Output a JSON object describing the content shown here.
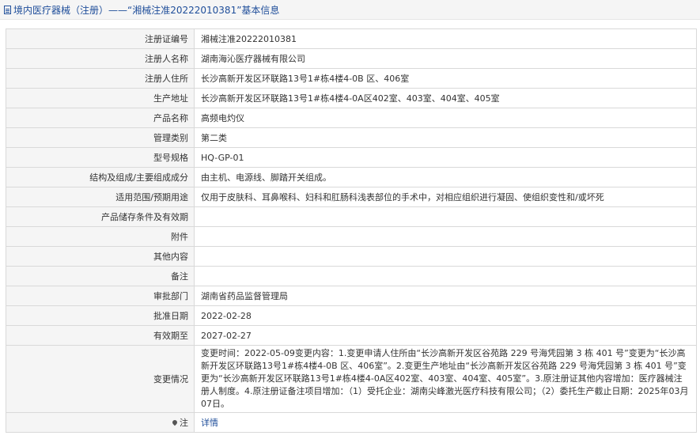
{
  "header": {
    "title": "境内医疗器械（注册）——“湘械注准20222010381”基本信息"
  },
  "rows": [
    {
      "label": "注册证编号",
      "value": "湘械注准20222010381"
    },
    {
      "label": "注册人名称",
      "value": "湖南海沁医疗器械有限公司"
    },
    {
      "label": "注册人住所",
      "value": "长沙高新开发区环联路13号1#栋4楼4-0B 区、406室"
    },
    {
      "label": "生产地址",
      "value": "长沙高新开发区环联路13号1#栋4楼4-0A区402室、403室、404室、405室"
    },
    {
      "label": "产品名称",
      "value": "高频电灼仪"
    },
    {
      "label": "管理类别",
      "value": "第二类"
    },
    {
      "label": "型号规格",
      "value": "HQ-GP-01"
    },
    {
      "label": "结构及组成/主要组成成分",
      "value": "由主机、电源线、脚踏开关组成。"
    },
    {
      "label": "适用范围/预期用途",
      "value": "仅用于皮肤科、耳鼻喉科、妇科和肛肠科浅表部位的手术中，对相应组织进行凝固、使组织变性和/或坏死"
    },
    {
      "label": "产品储存条件及有效期",
      "value": ""
    },
    {
      "label": "附件",
      "value": ""
    },
    {
      "label": "其他内容",
      "value": ""
    },
    {
      "label": "备注",
      "value": ""
    },
    {
      "label": "审批部门",
      "value": "湖南省药品监督管理局"
    },
    {
      "label": "批准日期",
      "value": "2022-02-28"
    },
    {
      "label": "有效期至",
      "value": "2027-02-27"
    }
  ],
  "change": {
    "label": "变更情况",
    "value": "变更时间：2022-05-09变更内容：1.变更申请人住所由“长沙高新开发区谷苑路 229 号海凭园第 3 栋 401 号”变更为“长沙高新开发区环联路13号1#栋4楼4-0B 区、406室”。2.变更生产地址由“长沙高新开发区谷苑路 229 号海凭园第 3 栋 401 号”变更为“长沙高新开发区环联路13号1#栋4楼4-0A区402室、403室、404室、405室”。3.原注册证其他内容增加：医疗器械注册人制度。4.原注册证备注项目增加：（1）受托企业：湖南尖峰激光医疗科技有限公司；（2）委托生产截止日期：2025年03月07日。"
  },
  "note": {
    "label": "注",
    "link_text": "详情"
  }
}
